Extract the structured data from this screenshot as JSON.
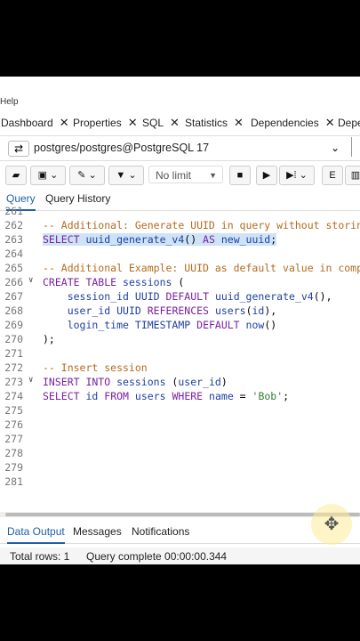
{
  "menubar": {
    "help_label": "Help"
  },
  "tabs": [
    {
      "label": "Dashboard"
    },
    {
      "label": "Properties"
    },
    {
      "label": "SQL"
    },
    {
      "label": "Statistics"
    },
    {
      "label": "Dependencies"
    },
    {
      "label": "Depe"
    }
  ],
  "connection": {
    "value": "postgres/postgres@PostgreSQL 17"
  },
  "toolbar": {
    "limit_value": "No limit"
  },
  "query_tabs": [
    {
      "label": "Query"
    },
    {
      "label": "Query History"
    }
  ],
  "editor_lines": [
    {
      "num": "261",
      "fold": "",
      "html": ""
    },
    {
      "num": "262",
      "fold": "",
      "html": "<span class='cm'>-- Additional: Generate UUID in query without storing</span>"
    },
    {
      "num": "263",
      "fold": "",
      "html": "<span class='hl'><span class='kw'>SELECT</span> <span class='fn'>uuid_generate_v4</span>() <span class='kw'>AS</span> <span class='fn'>new_uuid</span>;</span>"
    },
    {
      "num": "264",
      "fold": "",
      "html": ""
    },
    {
      "num": "265",
      "fold": "",
      "html": "<span class='cm'>-- Additional Example: UUID as default value in comp</span>"
    },
    {
      "num": "266",
      "fold": "∨",
      "html": "<span class='kw'>CREATE TABLE</span> <span class='plain'>sessions</span> ("
    },
    {
      "num": "267",
      "fold": "",
      "html": "    <span class='plain'>session_id</span> <span class='plain'>UUID</span> <span class='kw'>DEFAULT</span> <span class='fn'>uuid_generate_v4</span>(),"
    },
    {
      "num": "268",
      "fold": "",
      "html": "    <span class='plain'>user_id</span> <span class='plain'>UUID</span> <span class='kw'>REFERENCES</span> <span class='fn'>users</span>(<span class='fn'>id</span>),"
    },
    {
      "num": "269",
      "fold": "",
      "html": "    <span class='plain'>login_time</span> <span class='plain'>TIMESTAMP</span> <span class='kw'>DEFAULT</span> <span class='fn'>now</span>()"
    },
    {
      "num": "270",
      "fold": "",
      "html": ");"
    },
    {
      "num": "271",
      "fold": "",
      "html": ""
    },
    {
      "num": "272",
      "fold": "",
      "html": "<span class='cm'>-- Insert session</span>"
    },
    {
      "num": "273",
      "fold": "∨",
      "html": "<span class='kw'>INSERT INTO</span> <span class='plain'>sessions</span> (<span class='plain'>user_id</span>)"
    },
    {
      "num": "274",
      "fold": "",
      "html": "<span class='kw'>SELECT</span> <span class='plain'>id</span> <span class='kw'>FROM</span> <span class='plain'>users</span> <span class='kw'>WHERE</span> <span class='plain'>name</span> = <span class='st'>'Bob'</span>;"
    },
    {
      "num": "275",
      "fold": "",
      "html": ""
    },
    {
      "num": "276",
      "fold": "",
      "html": ""
    },
    {
      "num": "277",
      "fold": "",
      "html": ""
    },
    {
      "num": "278",
      "fold": "",
      "html": ""
    },
    {
      "num": "279",
      "fold": "",
      "html": ""
    },
    {
      "num": "281",
      "fold": "",
      "html": ""
    }
  ],
  "output_tabs": [
    {
      "label": "Data Output"
    },
    {
      "label": "Messages"
    },
    {
      "label": "Notifications"
    }
  ],
  "status": {
    "total_rows": "Total rows: 1",
    "query_complete": "Query complete 00:00:00.344"
  }
}
